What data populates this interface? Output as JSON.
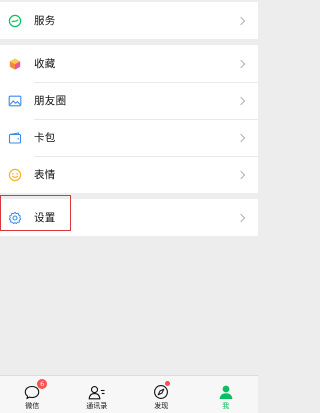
{
  "sections": [
    [
      {
        "id": "services",
        "label": "服务",
        "icon": "services-icon",
        "color": "#07c160"
      }
    ],
    [
      {
        "id": "favorites",
        "label": "收藏",
        "icon": "favorites-cube-icon",
        "color": "#f59f2a"
      },
      {
        "id": "moments",
        "label": "朋友圈",
        "icon": "album-icon",
        "color": "#3c8ce7"
      },
      {
        "id": "cards",
        "label": "卡包",
        "icon": "wallet-icon",
        "color": "#3c8ce7"
      },
      {
        "id": "stickers",
        "label": "表情",
        "icon": "smiley-icon",
        "color": "#f5b624"
      }
    ],
    [
      {
        "id": "settings",
        "label": "设置",
        "icon": "gear-icon",
        "color": "#3c8ce7",
        "highlighted": true
      }
    ]
  ],
  "tabbar": {
    "tabs": [
      {
        "id": "chats",
        "label": "微信",
        "badge": "6",
        "icon": "chat-bubble-icon"
      },
      {
        "id": "contacts",
        "label": "通讯录",
        "icon": "contacts-icon"
      },
      {
        "id": "discover",
        "label": "发现",
        "dot": true,
        "icon": "compass-icon"
      },
      {
        "id": "me",
        "label": "我",
        "active": true,
        "icon": "person-icon",
        "highlighted": true
      }
    ],
    "active_color": "#07c160",
    "badge_color": "#fa5151"
  },
  "highlight_color": "#d9373b"
}
